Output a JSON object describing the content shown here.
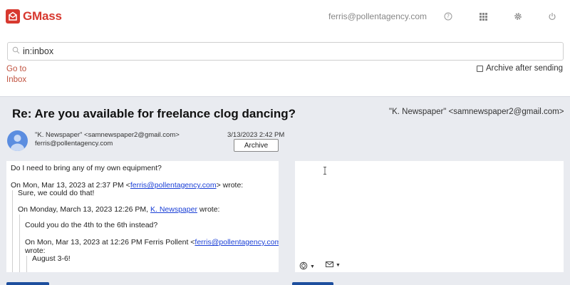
{
  "app": {
    "name": "GMass",
    "account": "ferris@pollentagency.com"
  },
  "top_icons": [
    "help-icon",
    "apps-grid-icon",
    "settings-gear-icon",
    "power-icon"
  ],
  "search": {
    "value": "in:inbox"
  },
  "nav": {
    "goto_line1": "Go to",
    "goto_line2": "Inbox",
    "archive_after_label": "Archive after sending",
    "archive_after_checked": false
  },
  "email": {
    "subject": "Re: Are you available for freelance clog dancing?",
    "header_from": "\"K. Newspaper\" <samnewspaper2@gmail.com>",
    "sender": "\"K. Newspaper\" <samnewspaper2@gmail.com>",
    "to": "ferris@pollentagency.com",
    "date": "3/13/2023 2:42 PM",
    "archive_label": "Archive",
    "body": {
      "line1": "Do I need to bring any of my own equipment?",
      "q1_pre": "On Mon, Mar 13, 2023 at 2:37 PM <",
      "q1_link": "ferris@pollentagency.com",
      "q1_post": "> wrote:",
      "q1_text": "Sure, we could do that!",
      "q2_pre": "On Monday, March 13, 2023 12:26 PM,",
      "q2_link": "K. Newspaper",
      "q2_post": "wrote:",
      "q2_text": "Could you do the 4th to the 6th instead?",
      "q3_pre": "On Mon, Mar 13, 2023 at 12:26 PM Ferris Pollent <",
      "q3_link": "ferris@pollentagency.com",
      "q3_post": ">",
      "q3_wrote": "wrote:",
      "q3_text": "August 3-6!"
    }
  },
  "colors": {
    "brand": "#d7382f",
    "link": "#1a3fd6",
    "panel_bg": "#e9ebf0",
    "avatar": "#5b8de0",
    "goto": "#c0523f"
  }
}
